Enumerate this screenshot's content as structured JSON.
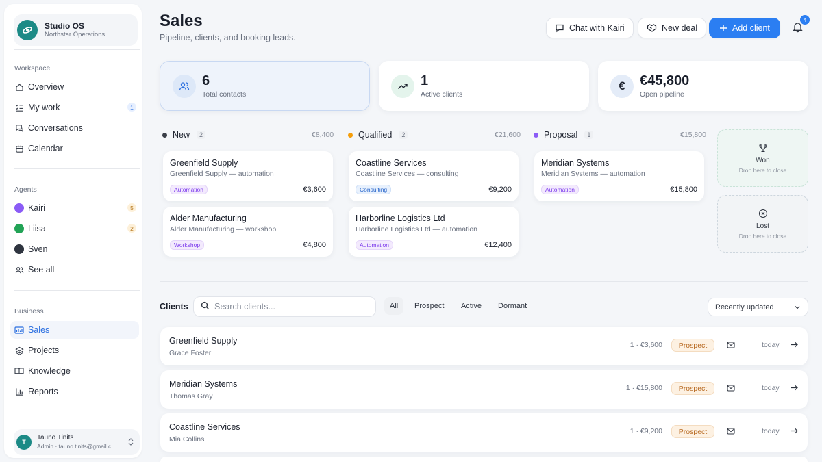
{
  "sidebar": {
    "brand": {
      "title": "Studio OS",
      "subtitle": "Northstar Operations"
    },
    "sections": {
      "workspace": "Workspace",
      "agents": "Agents",
      "business": "Business"
    },
    "workspace_items": [
      {
        "label": "Overview",
        "icon": "home-icon"
      },
      {
        "label": "My work",
        "icon": "checklist-icon",
        "badge": "1"
      },
      {
        "label": "Conversations",
        "icon": "chat-icon"
      },
      {
        "label": "Calendar",
        "icon": "calendar-icon"
      }
    ],
    "agent_items": [
      {
        "label": "Kairi",
        "badge": "5",
        "color": "#7c3aed"
      },
      {
        "label": "Liisa",
        "badge": "2",
        "color": "#22a356"
      },
      {
        "label": "Sven",
        "color": "#2f3540"
      },
      {
        "label": "See all",
        "icon": "users-icon"
      }
    ],
    "business_items": [
      {
        "label": "Sales",
        "icon": "sales-icon",
        "active": true
      },
      {
        "label": "Projects",
        "icon": "projects-icon"
      },
      {
        "label": "Knowledge",
        "icon": "book-icon"
      },
      {
        "label": "Reports",
        "icon": "chart-icon"
      }
    ],
    "user": {
      "initial": "T",
      "name": "Tauno Tinits",
      "sub": "Admin · tauno.tinits@gmail.c..."
    }
  },
  "header": {
    "title": "Sales",
    "subtitle": "Pipeline, clients, and booking leads.",
    "chat_label": "Chat with Kairi",
    "new_deal_label": "New deal",
    "add_client_label": "Add client",
    "notifications": "4"
  },
  "stats": [
    {
      "value": "6",
      "label": "Total contacts"
    },
    {
      "value": "1",
      "label": "Active clients"
    },
    {
      "value": "€45,800",
      "label": "Open pipeline"
    }
  ],
  "pipeline": {
    "columns": [
      {
        "name": "New",
        "count": "2",
        "total": "€8,400",
        "color": "#3b3f48"
      },
      {
        "name": "Qualified",
        "count": "2",
        "total": "€21,600",
        "color": "#f59e0b"
      },
      {
        "name": "Proposal",
        "count": "1",
        "total": "€15,800",
        "color": "#8b5cf6"
      }
    ],
    "deals": [
      {
        "name": "Greenfield Supply",
        "sub": "Greenfield Supply — automation",
        "tag": "Automation",
        "amount": "€3,600"
      },
      {
        "name": "Alder Manufacturing",
        "sub": "Alder Manufacturing — workshop",
        "tag": "Workshop",
        "amount": "€4,800"
      },
      {
        "name": "Coastline Services",
        "sub": "Coastline Services — consulting",
        "tag": "Consulting",
        "amount": "€9,200"
      },
      {
        "name": "Harborline Logistics Ltd",
        "sub": "Harborline Logistics Ltd — automation",
        "tag": "Automation",
        "amount": "€12,400"
      },
      {
        "name": "Meridian Systems",
        "sub": "Meridian Systems — automation",
        "tag": "Automation",
        "amount": "€15,800"
      }
    ],
    "drop_won": {
      "title": "Won",
      "hint": "Drop here to close"
    },
    "drop_lost": {
      "title": "Lost",
      "hint": "Drop here to close"
    }
  },
  "clients": {
    "label": "Clients",
    "search_placeholder": "Search clients...",
    "filters": [
      "All",
      "Prospect",
      "Active",
      "Dormant"
    ],
    "sort": "Recently updated",
    "rows": [
      {
        "name": "Greenfield Supply",
        "contact": "Grace Foster",
        "meta": "1 · €3,600",
        "status": "Prospect",
        "updated": "today"
      },
      {
        "name": "Meridian Systems",
        "contact": "Thomas Gray",
        "meta": "1 · €15,800",
        "status": "Prospect",
        "updated": "today"
      },
      {
        "name": "Coastline Services",
        "contact": "Mia Collins",
        "meta": "1 · €9,200",
        "status": "Prospect",
        "updated": "today"
      }
    ]
  }
}
